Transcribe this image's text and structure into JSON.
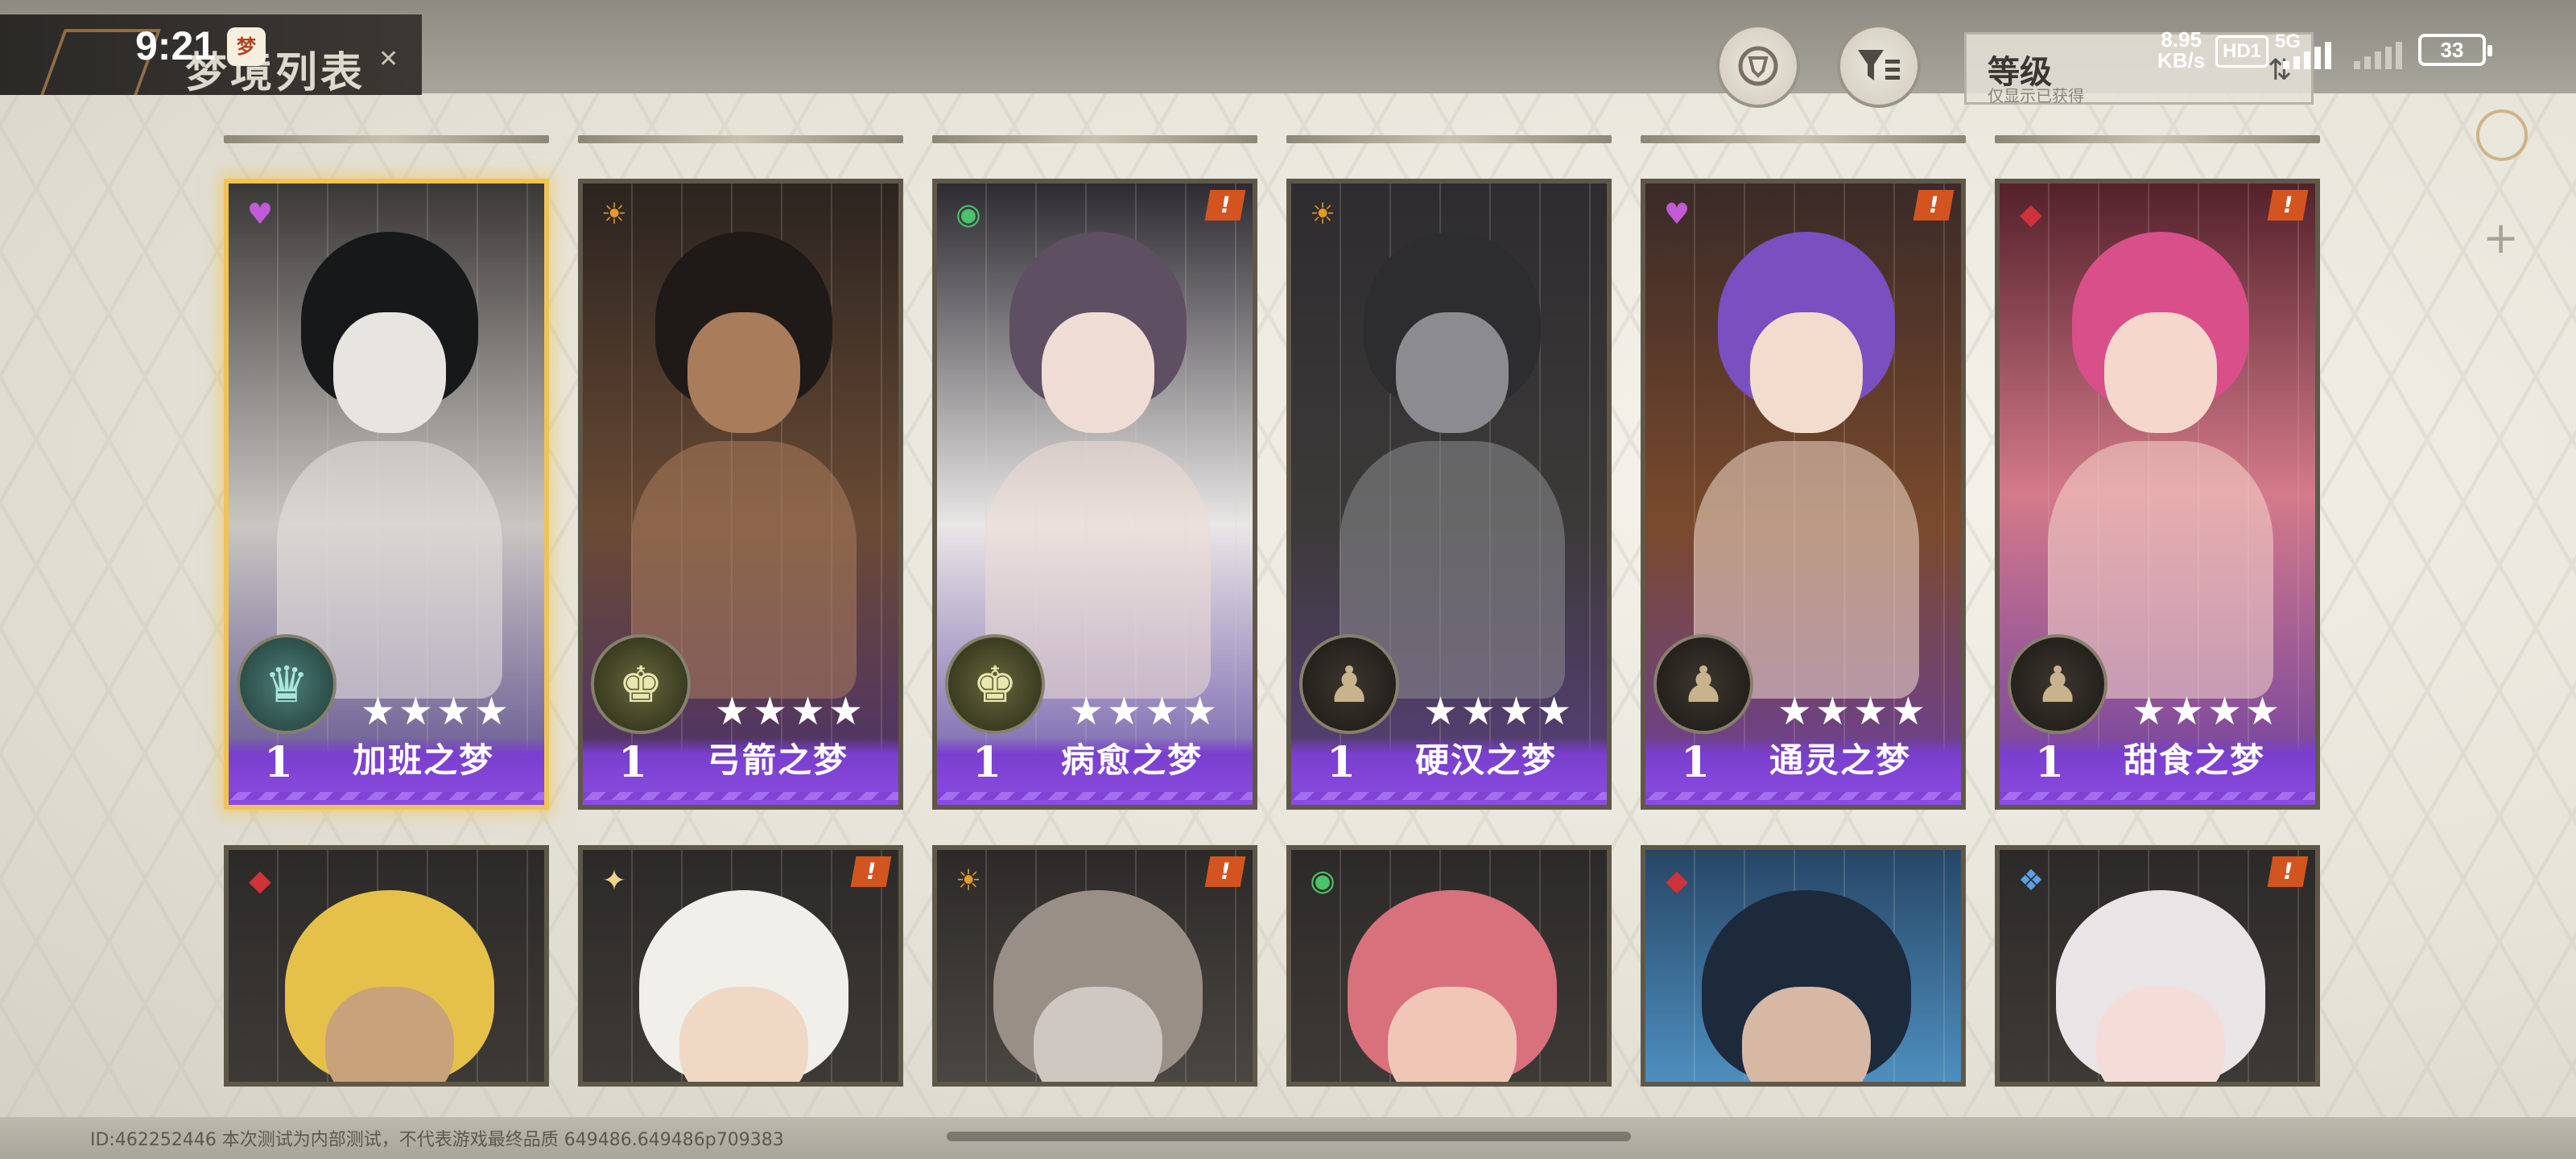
{
  "header": {
    "title": "梦境列表",
    "app_badge": "梦"
  },
  "status_bar": {
    "time": "9:21",
    "net_speed_top": "8.95",
    "net_speed_unit": "KB/s",
    "hd": "HD1",
    "network": "5G",
    "battery": "33"
  },
  "toolbar": {
    "sort_label": "等级",
    "sort_sub": "仅显示已获得",
    "sort_chevron": "⇅"
  },
  "icons": {
    "shield_button": "shield-icon",
    "filter_button": "filter-icon",
    "side_ring": "ring-icon",
    "side_plus": "plus-icon"
  },
  "cards_row1": [
    {
      "level": "1",
      "name": "加班之梦",
      "stars": "★★★★",
      "rank": "queen",
      "attr": "heart",
      "alert": false,
      "selected": true
    },
    {
      "level": "1",
      "name": "弓箭之梦",
      "stars": "★★★★",
      "rank": "king",
      "attr": "sun",
      "alert": false,
      "selected": false
    },
    {
      "level": "1",
      "name": "病愈之梦",
      "stars": "★★★★",
      "rank": "king",
      "attr": "planet",
      "alert": true,
      "selected": false
    },
    {
      "level": "1",
      "name": "硬汉之梦",
      "stars": "★★★★",
      "rank": "pawn",
      "attr": "sun",
      "alert": false,
      "selected": false
    },
    {
      "level": "1",
      "name": "通灵之梦",
      "stars": "★★★★",
      "rank": "pawn",
      "attr": "heart",
      "alert": true,
      "selected": false
    },
    {
      "level": "1",
      "name": "甜食之梦",
      "stars": "★★★★",
      "rank": "pawn",
      "attr": "gem",
      "alert": true,
      "selected": false
    }
  ],
  "cards_row2": [
    {
      "attr": "gem",
      "alert": false
    },
    {
      "attr": "star",
      "alert": true
    },
    {
      "attr": "sun",
      "alert": true
    },
    {
      "attr": "planet",
      "alert": false
    },
    {
      "attr": "gem",
      "alert": false
    },
    {
      "attr": "crystal",
      "alert": true
    }
  ],
  "glyphs": {
    "alert": "!",
    "queen": "♛",
    "king": "♚",
    "pawn": "♟",
    "heart": "♥",
    "sun": "☀",
    "planet": "◉",
    "gem": "◆",
    "star": "✦",
    "crystal": "❖",
    "close": "✕",
    "plus": "+"
  },
  "footer": {
    "text": "ID:462252446 本次测试为内部测试，不代表游戏最终品质 649486.649486p709383"
  },
  "colors": {
    "accent_gold": "#efc454",
    "card_purple": "#8b4ce0",
    "alert_orange": "#d4541f"
  }
}
